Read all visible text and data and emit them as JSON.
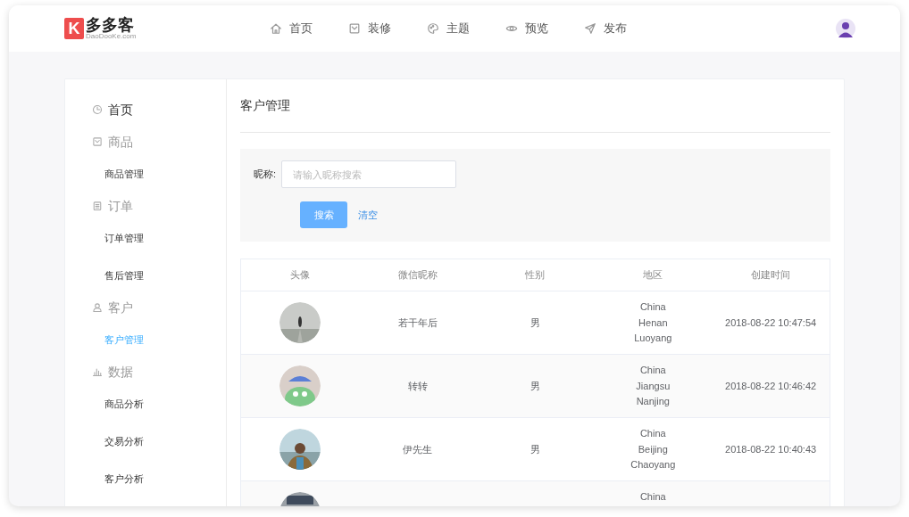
{
  "logo": {
    "mark": "K",
    "name": "多多客",
    "domain": "DaoDooKe.com"
  },
  "nav": [
    {
      "label": "首页"
    },
    {
      "label": "装修"
    },
    {
      "label": "主题"
    },
    {
      "label": "预览"
    },
    {
      "label": "发布"
    }
  ],
  "sidebar": {
    "items": [
      {
        "label": "首页",
        "selected": false
      },
      {
        "label": "商品",
        "selected": false,
        "children": [
          {
            "label": "商品管理",
            "selected": false
          }
        ]
      },
      {
        "label": "订单",
        "selected": false,
        "children": [
          {
            "label": "订单管理",
            "selected": false
          },
          {
            "label": "售后管理",
            "selected": false
          }
        ]
      },
      {
        "label": "客户",
        "selected": false,
        "children": [
          {
            "label": "客户管理",
            "selected": true
          }
        ]
      },
      {
        "label": "数据",
        "selected": false,
        "children": [
          {
            "label": "商品分析",
            "selected": false
          },
          {
            "label": "交易分析",
            "selected": false
          },
          {
            "label": "客户分析",
            "selected": false
          }
        ]
      }
    ]
  },
  "page_title": "客户管理",
  "search": {
    "label": "昵称:",
    "placeholder": "请输入昵称搜索",
    "search_button": "搜索",
    "clear_button": "清空"
  },
  "table": {
    "columns": [
      "头像",
      "微信昵称",
      "性别",
      "地区",
      "创建时间"
    ],
    "rows": [
      {
        "nickname": "若干年后",
        "gender": "男",
        "region": [
          "China",
          "Henan",
          "Luoyang"
        ],
        "created": "2018-08-22 10:47:54"
      },
      {
        "nickname": "转转",
        "gender": "男",
        "region": [
          "China",
          "Jiangsu",
          "Nanjing"
        ],
        "created": "2018-08-22 10:46:42"
      },
      {
        "nickname": "伊先生",
        "gender": "男",
        "region": [
          "China",
          "Beijing",
          "Chaoyang"
        ],
        "created": "2018-08-22 10:40:43"
      },
      {
        "region": [
          "China"
        ]
      }
    ]
  }
}
